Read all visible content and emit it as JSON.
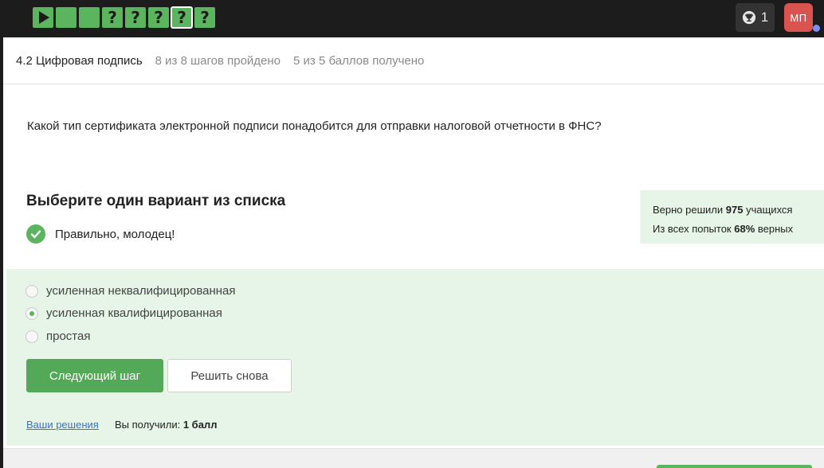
{
  "topbar": {
    "steps": [
      {
        "type": "video",
        "label": ""
      },
      {
        "type": "text",
        "label": ""
      },
      {
        "type": "text",
        "label": ""
      },
      {
        "type": "quiz",
        "label": "?"
      },
      {
        "type": "quiz",
        "label": "?"
      },
      {
        "type": "quiz",
        "label": "?"
      },
      {
        "type": "quiz",
        "label": "?",
        "active": true
      },
      {
        "type": "quiz",
        "label": "?"
      }
    ],
    "trophy_icon": "trophy-icon",
    "trophy_count": "1",
    "avatar_initials": "МП",
    "accent_color": "#5bb55f"
  },
  "header": {
    "lesson_title": "4.2 Цифровая подпись",
    "steps_progress": "8 из 8 шагов пройдено",
    "points_progress": "5 из 5 баллов  получено"
  },
  "question": {
    "text": "Какой тип сертификата электронной подписи понадобится для отправки налоговой отчетности в ФНС?"
  },
  "quiz": {
    "title": "Выберите один вариант из списка",
    "feedback": "Правильно, молодец!",
    "options": [
      {
        "label": "усиленная неквалифицированная",
        "checked": false
      },
      {
        "label": "усиленная квалифицированная",
        "checked": true
      },
      {
        "label": "простая",
        "checked": false
      }
    ],
    "next_button": "Следующий шаг",
    "retry_button": "Решить снова",
    "solutions_link": "Ваши решения",
    "score_prefix": "Вы получили:",
    "score_value": "1 балл"
  },
  "stats": {
    "solved_prefix": "Верно решили",
    "solved_count": "975",
    "solved_suffix": "учащихся",
    "attempts_prefix": "Из всех попыток",
    "attempts_percent": "68%",
    "attempts_suffix": "верных"
  }
}
